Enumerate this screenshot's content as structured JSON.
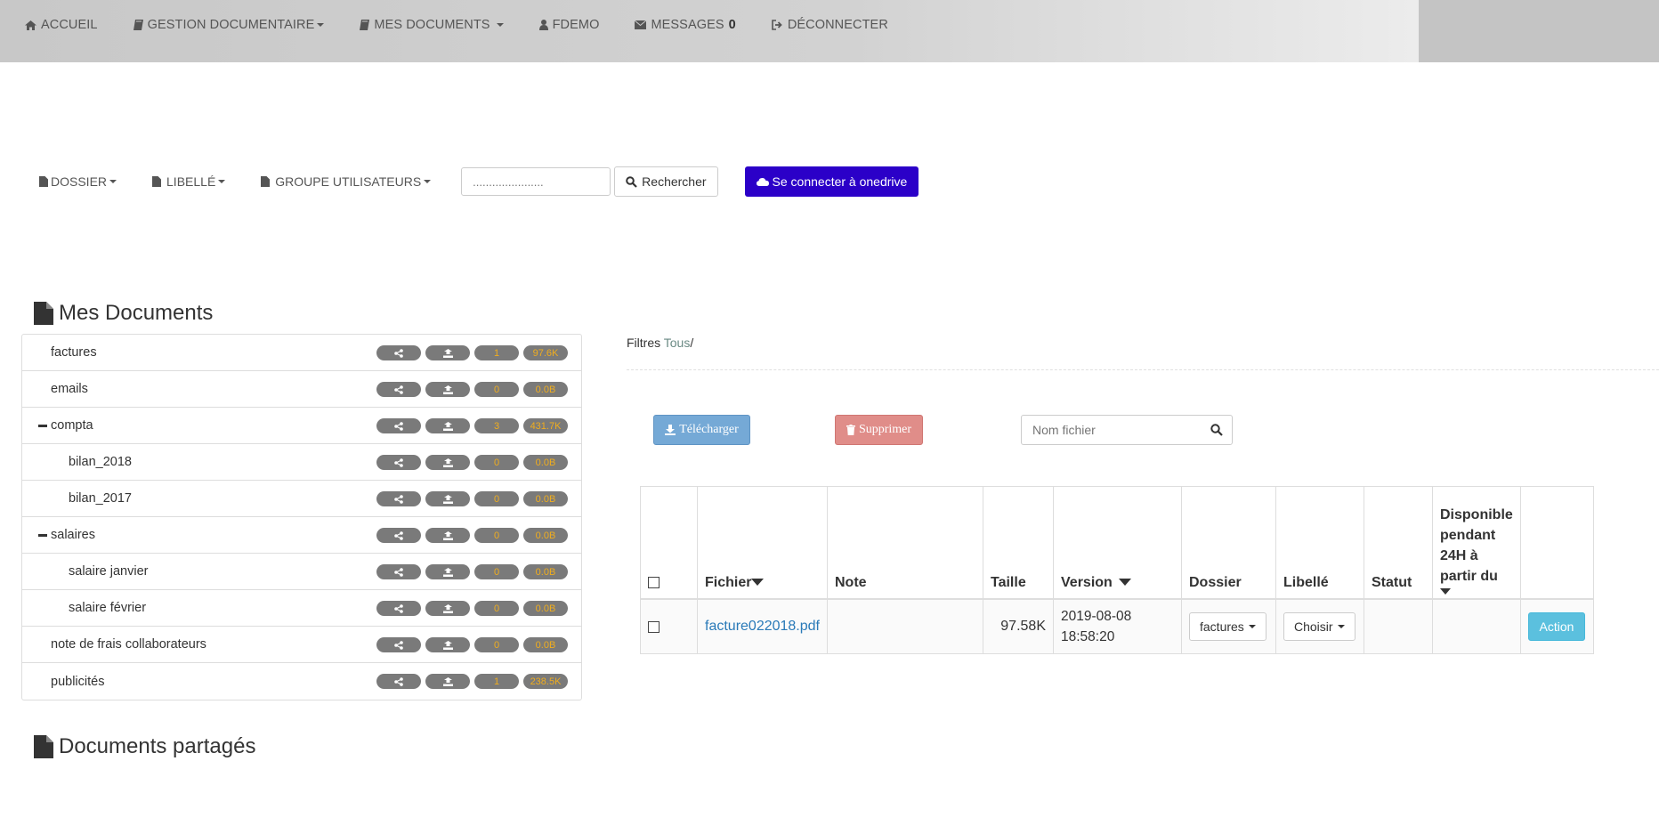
{
  "navbar": {
    "items": [
      {
        "label": "Accueil",
        "icon": "home-icon",
        "caret": false
      },
      {
        "label": "Gestion documentaire",
        "icon": "book-icon",
        "caret": true
      },
      {
        "label": "Mes documents",
        "icon": "book-icon",
        "caret": true
      },
      {
        "label": "fdemo",
        "icon": "user-icon",
        "caret": false
      },
      {
        "label": "Messages",
        "icon": "envelope-icon",
        "caret": false,
        "badge": "0"
      },
      {
        "label": "Déconnecter",
        "icon": "sign-out-icon",
        "caret": false
      }
    ]
  },
  "toolbar": {
    "dossier_label": "Dossier",
    "libelle_label": "Libellé",
    "groupe_label": "Groupe utilisateurs",
    "search_placeholder": "......................",
    "search_button": "Rechercher",
    "onedrive_button": "Se connecter à onedrive"
  },
  "sections": {
    "my_documents": "Mes Documents",
    "shared_documents": "Documents partagés"
  },
  "tree": [
    {
      "label": "factures",
      "count": "1",
      "size": "97.6K",
      "indent": 1,
      "expanded": false
    },
    {
      "label": "emails",
      "count": "0",
      "size": "0.0B",
      "indent": 1,
      "expanded": false
    },
    {
      "label": "compta",
      "count": "3",
      "size": "431.7K",
      "indent": 1,
      "expanded": true
    },
    {
      "label": "bilan_2018",
      "count": "0",
      "size": "0.0B",
      "indent": 2,
      "expanded": false
    },
    {
      "label": "bilan_2017",
      "count": "0",
      "size": "0.0B",
      "indent": 2,
      "expanded": false
    },
    {
      "label": "salaires",
      "count": "0",
      "size": "0.0B",
      "indent": 1,
      "expanded": true
    },
    {
      "label": "salaire janvier",
      "count": "0",
      "size": "0.0B",
      "indent": 2,
      "expanded": false
    },
    {
      "label": "salaire février",
      "count": "0",
      "size": "0.0B",
      "indent": 2,
      "expanded": false
    },
    {
      "label": "note de frais collaborateurs",
      "count": "0",
      "size": "0.0B",
      "indent": 1,
      "expanded": false
    },
    {
      "label": "publicités",
      "count": "1",
      "size": "238.5K",
      "indent": 1,
      "expanded": false
    }
  ],
  "filters": {
    "label": "Filtres",
    "value": "Tous",
    "separator": "/"
  },
  "actions": {
    "download": "Télécharger",
    "delete": "Supprimer",
    "file_search_placeholder": "Nom fichier"
  },
  "table": {
    "headers": {
      "fichier": "Fichier",
      "note": "Note",
      "taille": "Taille",
      "version": "Version",
      "dossier": "Dossier",
      "libelle": "Libellé",
      "statut": "Statut",
      "disponible": "Disponible pendant 24H à partir du"
    },
    "rows": [
      {
        "fichier": "facture022018.pdf",
        "note": "",
        "taille": "97.58K",
        "version_date": "2019-08-08",
        "version_time": "18:58:20",
        "dossier": "factures",
        "libelle": "Choisir",
        "statut": "",
        "disponible": "",
        "action": "Action"
      }
    ]
  },
  "colors": {
    "onedrive": "#2b00c8",
    "download": "#75a9d6",
    "delete": "#e08d89",
    "action": "#5bc0de",
    "pill_bg": "#7a7a7a",
    "pill_text": "#f0ad1e",
    "link": "#2a7ab8"
  }
}
